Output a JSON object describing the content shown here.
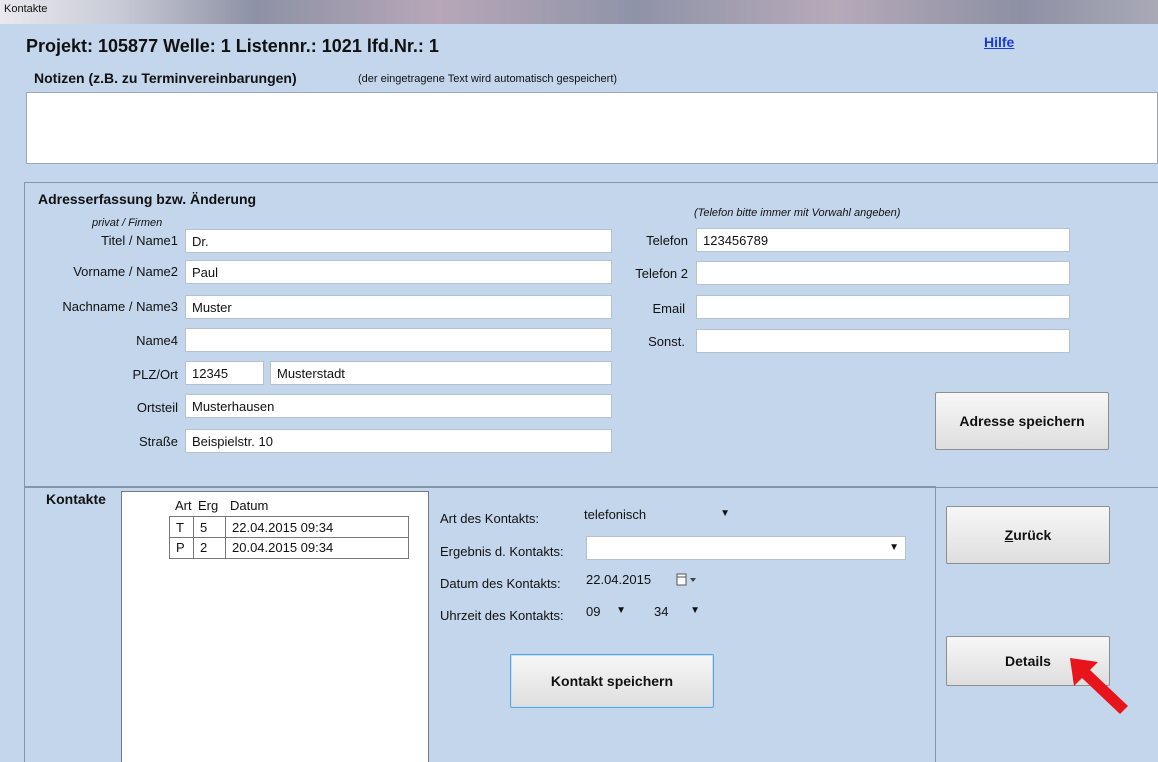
{
  "window": {
    "title": "Kontakte"
  },
  "header": {
    "text": "Projekt: 105877  Welle: 1  Listennr.: 1021  lfd.Nr.: 1",
    "help_link": "Hilfe"
  },
  "notes": {
    "label": "Notizen (z.B. zu Terminvereinbarungen)",
    "hint": "(der eingetragene Text wird automatisch gespeichert)",
    "value": ""
  },
  "address": {
    "title": "Adresserfassung bzw. Änderung",
    "subtitle": "privat / Firmen",
    "phone_hint": "(Telefon bitte immer mit Vorwahl angeben)",
    "fields": {
      "titel_label": "Titel / Name1",
      "titel_value": "Dr.",
      "vorname_label": "Vorname / Name2",
      "vorname_value": "Paul",
      "nachname_label": "Nachname / Name3",
      "nachname_value": "Muster",
      "name4_label": "Name4",
      "name4_value": "",
      "plzort_label": "PLZ/Ort",
      "plz_value": "12345",
      "ort_value": "Musterstadt",
      "ortsteil_label": "Ortsteil",
      "ortsteil_value": "Musterhausen",
      "strasse_label": "Straße",
      "strasse_value": "Beispielstr. 10",
      "telefon_label": "Telefon",
      "telefon_value": "123456789",
      "telefon2_label": "Telefon 2",
      "telefon2_value": "",
      "email_label": "Email",
      "email_value": "",
      "sonst_label": "Sonst.",
      "sonst_value": ""
    },
    "save_button": "Adresse speichern"
  },
  "contacts": {
    "label": "Kontakte",
    "columns": [
      "Art",
      "Erg",
      "Datum"
    ],
    "rows": [
      {
        "art": "T",
        "erg": "5",
        "datum": "22.04.2015 09:34"
      },
      {
        "art": "P",
        "erg": "2",
        "datum": "20.04.2015 09:34"
      }
    ],
    "form": {
      "art_label": "Art des Kontakts:",
      "art_value": "telefonisch",
      "ergebnis_label": "Ergebnis d. Kontakts:",
      "ergebnis_value": "",
      "datum_label": "Datum des Kontakts:",
      "datum_value": "22.04.2015",
      "uhrzeit_label": "Uhrzeit des Kontakts:",
      "hour_value": "09",
      "minute_value": "34"
    },
    "save_button": "Kontakt speichern"
  },
  "buttons": {
    "back": "Zurück",
    "back_accesskey": "Z",
    "back_rest": "urück",
    "details": "Details"
  },
  "colors": {
    "background": "#c4d6ec",
    "link": "#1a3bd6",
    "arrow": "#e8141b"
  },
  "icons": {
    "calendar": "calendar-icon",
    "dropdown": "chevron-down-icon",
    "pointer_arrow": "red-arrow-icon"
  }
}
